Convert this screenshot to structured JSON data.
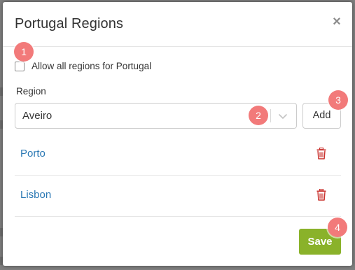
{
  "modal": {
    "title": "Portugal Regions",
    "close_label": "×"
  },
  "allow_all": {
    "label": "Allow all regions for Portugal",
    "checked": false
  },
  "region_field": {
    "label": "Region",
    "selected_value": "Aveiro"
  },
  "add_button": {
    "label": "Add"
  },
  "regions": [
    {
      "name": "Porto"
    },
    {
      "name": "Lisbon"
    }
  ],
  "save_button": {
    "label": "Save"
  },
  "annotations": [
    {
      "label": "1"
    },
    {
      "label": "2"
    },
    {
      "label": "3"
    },
    {
      "label": "4"
    }
  ],
  "colors": {
    "accent_green": "#8ab22a",
    "link_blue": "#2a78b4",
    "delete_red": "#c9302c",
    "badge": "#f27a7a",
    "overlay": "#7f7f7f"
  },
  "icons": {
    "close": "close-icon",
    "dropdown": "chevron-down-icon",
    "delete": "trash-icon"
  }
}
